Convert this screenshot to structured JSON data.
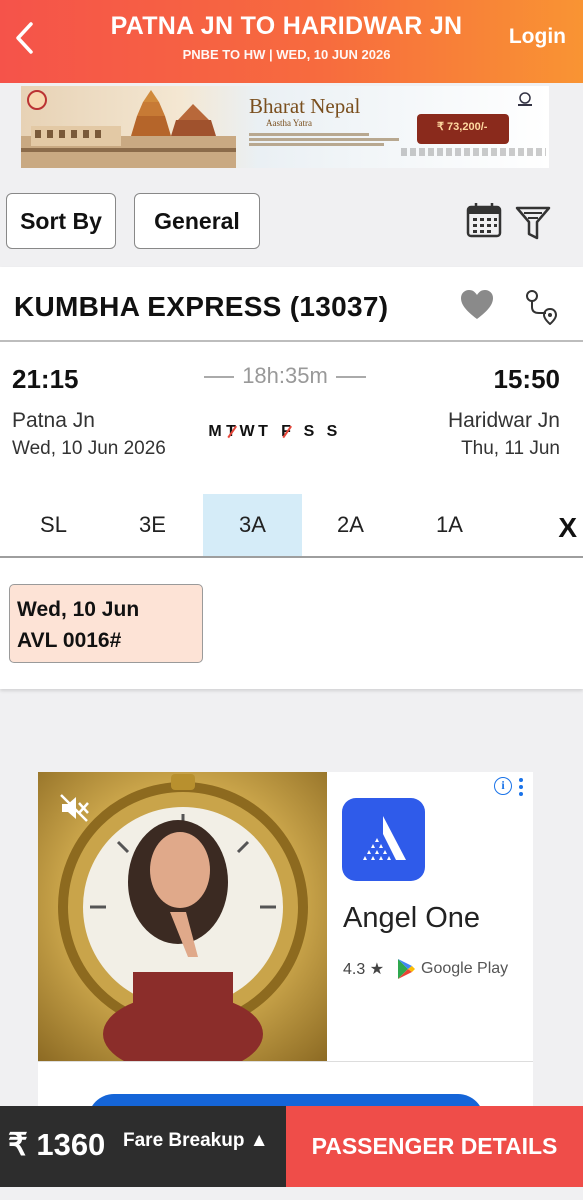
{
  "header": {
    "title": "PATNA JN TO HARIDWAR JN",
    "subtitle": "PNBE TO HW | WED, 10 JUN  2026",
    "login_label": "Login"
  },
  "banner": {
    "title": "Bharat Nepal",
    "subtitle": "Aastha Yatra",
    "price": "₹ 73,200/-"
  },
  "filters": {
    "sort_label": "Sort By",
    "quota_label": "General"
  },
  "train": {
    "name": "KUMBHA EXPRESS (13037)",
    "departure_time": "21:15",
    "arrival_time": "15:50",
    "duration": "18h:35m",
    "from_station": "Patna Jn",
    "to_station": "Haridwar Jn",
    "departure_date": "Wed, 10 Jun  2026",
    "arrival_date": "Thu, 11 Jun",
    "run_days": [
      {
        "label": "M",
        "runs": true
      },
      {
        "label": "T",
        "runs": false
      },
      {
        "label": "W",
        "runs": true
      },
      {
        "label": "T",
        "runs": true
      },
      {
        "label": "F",
        "runs": false
      },
      {
        "label": "S",
        "runs": true
      },
      {
        "label": "S",
        "runs": true
      }
    ]
  },
  "classes": {
    "tabs": [
      "SL",
      "3E",
      "3A",
      "2A",
      "1A"
    ],
    "selected": "3A",
    "close_label": "X"
  },
  "availability": {
    "date": "Wed, 10 Jun",
    "status": "AVL 0016#"
  },
  "ad": {
    "app_name": "Angel One",
    "rating": "4.3 ★",
    "store": "Google Play"
  },
  "bottom": {
    "price": "₹ 1360",
    "fare_breakup_label": "Fare Breakup ▲",
    "passenger_button": "PASSENGER DETAILS"
  },
  "colors": {
    "header_gradient_start": "#f5534a",
    "header_gradient_end": "#f99433",
    "selected_class_bg": "#d5ecf8",
    "availability_bg": "#fde3d6",
    "cta_red": "#ef4d49",
    "bottom_dark": "#2d2d2d"
  },
  "icons": {
    "back": "chevron-left-icon",
    "calendar": "calendar-icon",
    "filter": "filter-funnel-icon",
    "favorite": "heart-icon",
    "route": "route-map-icon",
    "mute": "mute-icon",
    "info": "info-icon"
  }
}
